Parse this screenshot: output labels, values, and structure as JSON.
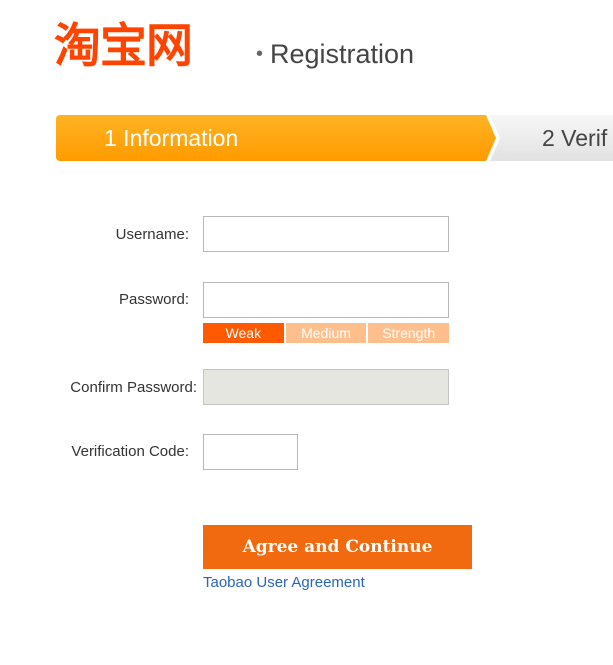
{
  "header": {
    "logo_text": "淘宝网",
    "separator": "•",
    "title": "Registration"
  },
  "steps": [
    {
      "label": "1 Information",
      "active": true
    },
    {
      "label": "2 Verif",
      "active": false
    }
  ],
  "form": {
    "username": {
      "label": "Username:",
      "value": "",
      "placeholder": ""
    },
    "password": {
      "label": "Password:",
      "value": "",
      "placeholder": ""
    },
    "strength": {
      "weak": "Weak",
      "medium": "Medium",
      "strong": "Strength",
      "level": 1,
      "of": 3
    },
    "confirm_password": {
      "label": "Confirm Password:",
      "value": "",
      "placeholder": "",
      "disabled": true
    },
    "verification_code": {
      "label": "Verification Code:",
      "value": "",
      "placeholder": ""
    },
    "submit_label": "Agree and Continue",
    "agreement_link": "Taobao User Agreement"
  },
  "colors": {
    "brand": "#ff4400",
    "step_active": "#ff9b00",
    "button": "#f26a10",
    "strength_active": "#ff5a00",
    "strength_inactive": "#ffbf8c",
    "link": "#2a66b8"
  }
}
